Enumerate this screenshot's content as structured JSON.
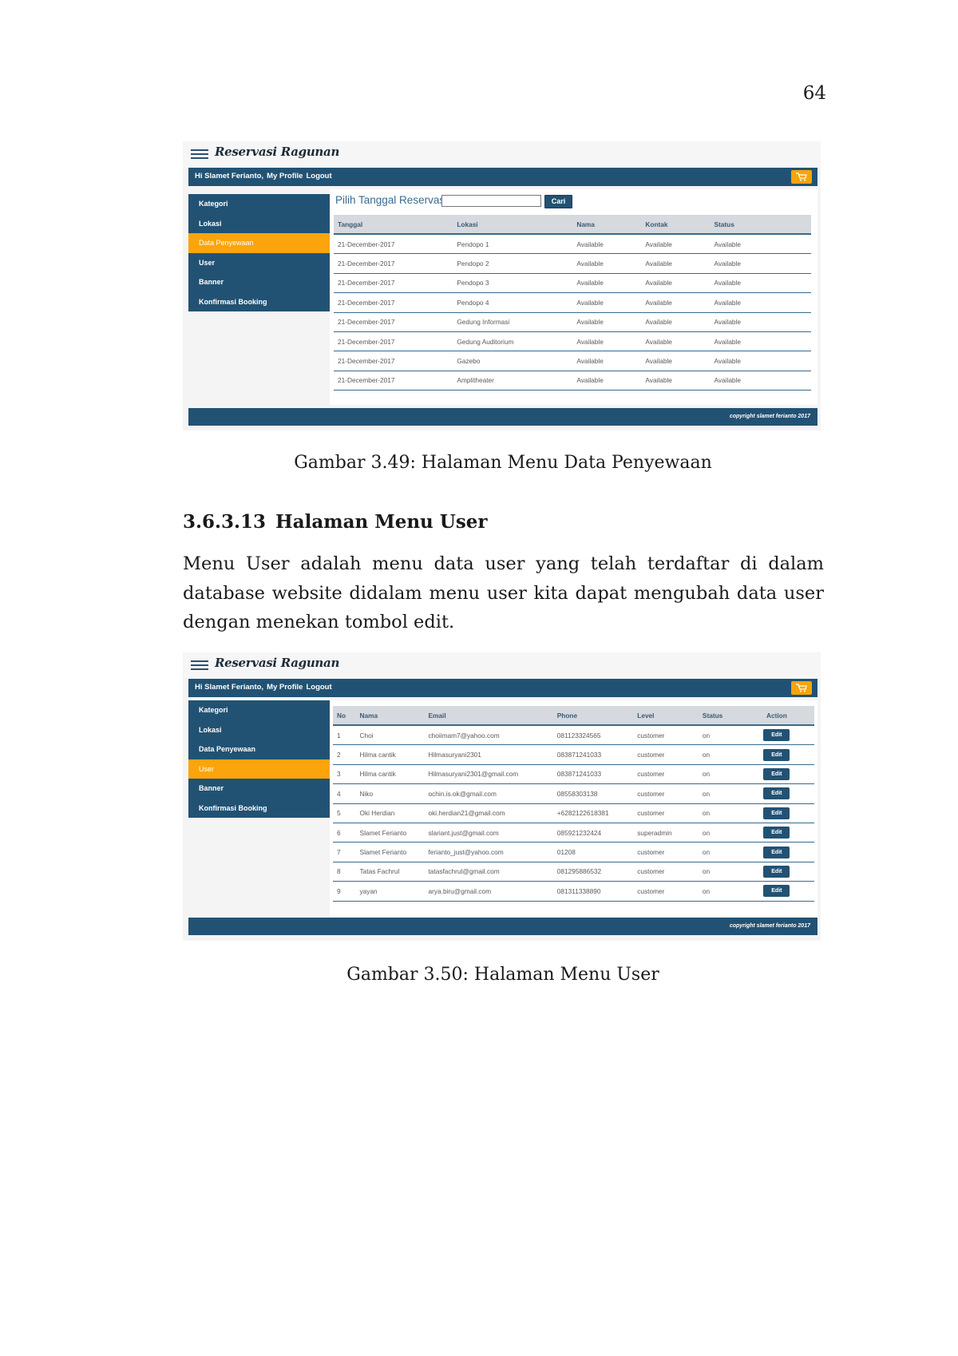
{
  "page_number": "64",
  "figure1": {
    "brand": "Reservasi Ragunan",
    "greeting": [
      "Hi Slamet Ferianto,",
      "My Profile",
      "Logout"
    ],
    "sidebar": [
      "Kategori",
      "Lokasi",
      "Data Penyewaan",
      "User",
      "Banner",
      "Konfirmasi Booking"
    ],
    "active_menu": "Data Penyewaan",
    "date_label": "Pilih Tanggal Reservasi",
    "date_value": "",
    "search_button": "Cari",
    "headers": [
      "Tanggal",
      "Lokasi",
      "Nama",
      "Kontak",
      "Status"
    ],
    "rows": [
      [
        "21-December-2017",
        "Pendopo 1",
        "Available",
        "Available",
        "Available"
      ],
      [
        "21-December-2017",
        "Pendopo 2",
        "Available",
        "Available",
        "Available"
      ],
      [
        "21-December-2017",
        "Pendopo 3",
        "Available",
        "Available",
        "Available"
      ],
      [
        "21-December-2017",
        "Pendopo 4",
        "Available",
        "Available",
        "Available"
      ],
      [
        "21-December-2017",
        "Gedung Informasi",
        "Available",
        "Available",
        "Available"
      ],
      [
        "21-December-2017",
        "Gedung Auditorium",
        "Available",
        "Available",
        "Available"
      ],
      [
        "21-December-2017",
        "Gazebo",
        "Available",
        "Available",
        "Available"
      ],
      [
        "21-December-2017",
        "Amplitheater",
        "Available",
        "Available",
        "Available"
      ]
    ],
    "copyright": "copyright slamet ferianto 2017",
    "caption": "Gambar 3.49: Halaman Menu Data Penyewaan"
  },
  "section": {
    "number": "3.6.3.13",
    "title": "Halaman Menu User",
    "paragraph": "Menu User adalah menu data user yang telah terdaftar di dalam database website didalam menu user kita dapat mengubah data user dengan menekan tombol edit."
  },
  "figure2": {
    "brand": "Reservasi Ragunan",
    "greeting": [
      "Hi Slamet Ferianto,",
      "My Profile",
      "Logout"
    ],
    "sidebar": [
      "Kategori",
      "Lokasi",
      "Data Penyewaan",
      "User",
      "Banner",
      "Konfirmasi Booking"
    ],
    "active_menu": "User",
    "headers": [
      "No",
      "Nama",
      "Email",
      "Phone",
      "Level",
      "Status",
      "Action"
    ],
    "rows": [
      [
        "1",
        "Choi",
        "choiimam7@yahoo.com",
        "081123324565",
        "customer",
        "on",
        "Edit"
      ],
      [
        "2",
        "Hilma cantik",
        "Hilmasuryani2301",
        "083871241033",
        "customer",
        "on",
        "Edit"
      ],
      [
        "3",
        "Hilma cantik",
        "Hilmasuryani2301@gmail.com",
        "083871241033",
        "customer",
        "on",
        "Edit"
      ],
      [
        "4",
        "Niko",
        "ochin.is.ok@gmail.com",
        "08558303138",
        "customer",
        "on",
        "Edit"
      ],
      [
        "5",
        "Oki Herdian",
        "oki.herdian21@gmail.com",
        "+6282122618381",
        "customer",
        "on",
        "Edit"
      ],
      [
        "6",
        "Slamet Ferianto",
        "slariant.just@gmail.com",
        "085921232424",
        "superadmin",
        "on",
        "Edit"
      ],
      [
        "7",
        "Slamet Ferianto",
        "ferianto_just@yahoo.com",
        "01208",
        "customer",
        "on",
        "Edit"
      ],
      [
        "8",
        "Tatas Fachrul",
        "tatasfachrul@gmail.com",
        "081295886532",
        "customer",
        "on",
        "Edit"
      ],
      [
        "9",
        "yayan",
        "arya.biru@gmail.com",
        "081311338890",
        "customer",
        "on",
        "Edit"
      ]
    ],
    "copyright": "copyright slamet ferianto 2017",
    "caption": "Gambar 3.50: Halaman Menu User"
  }
}
